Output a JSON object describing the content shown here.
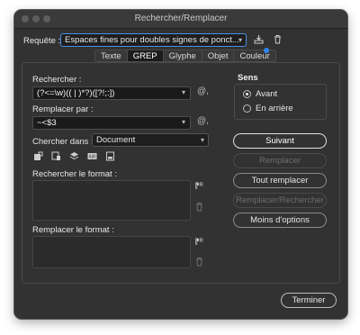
{
  "window": {
    "title": "Rechercher/Remplacer"
  },
  "query": {
    "label": "Requête :",
    "value": "Espaces fines pour doubles signes de ponct..."
  },
  "tabs": [
    "Texte",
    "GREP",
    "Glyphe",
    "Objet",
    "Couleur"
  ],
  "search": {
    "label": "Rechercher :",
    "value": "(?<=\\w)(( | )*?)([?!;:])"
  },
  "replace": {
    "label": "Remplacer par :",
    "value": "~<$3"
  },
  "search_in": {
    "label": "Chercher dans :",
    "value": "Document"
  },
  "find_format": {
    "label": "Rechercher le format :"
  },
  "replace_format": {
    "label": "Remplacer le format :"
  },
  "direction": {
    "label": "Sens",
    "forward": "Avant",
    "backward": "En arrière",
    "selected": "Avant"
  },
  "buttons": {
    "next": "Suivant",
    "replace": "Remplacer",
    "replace_all": "Tout remplacer",
    "replace_find": "Remplacer/Rechercher",
    "fewer_options": "Moins d'options",
    "done": "Terminer"
  },
  "colors": {
    "accent": "#2f84f0",
    "background": "#323232"
  }
}
